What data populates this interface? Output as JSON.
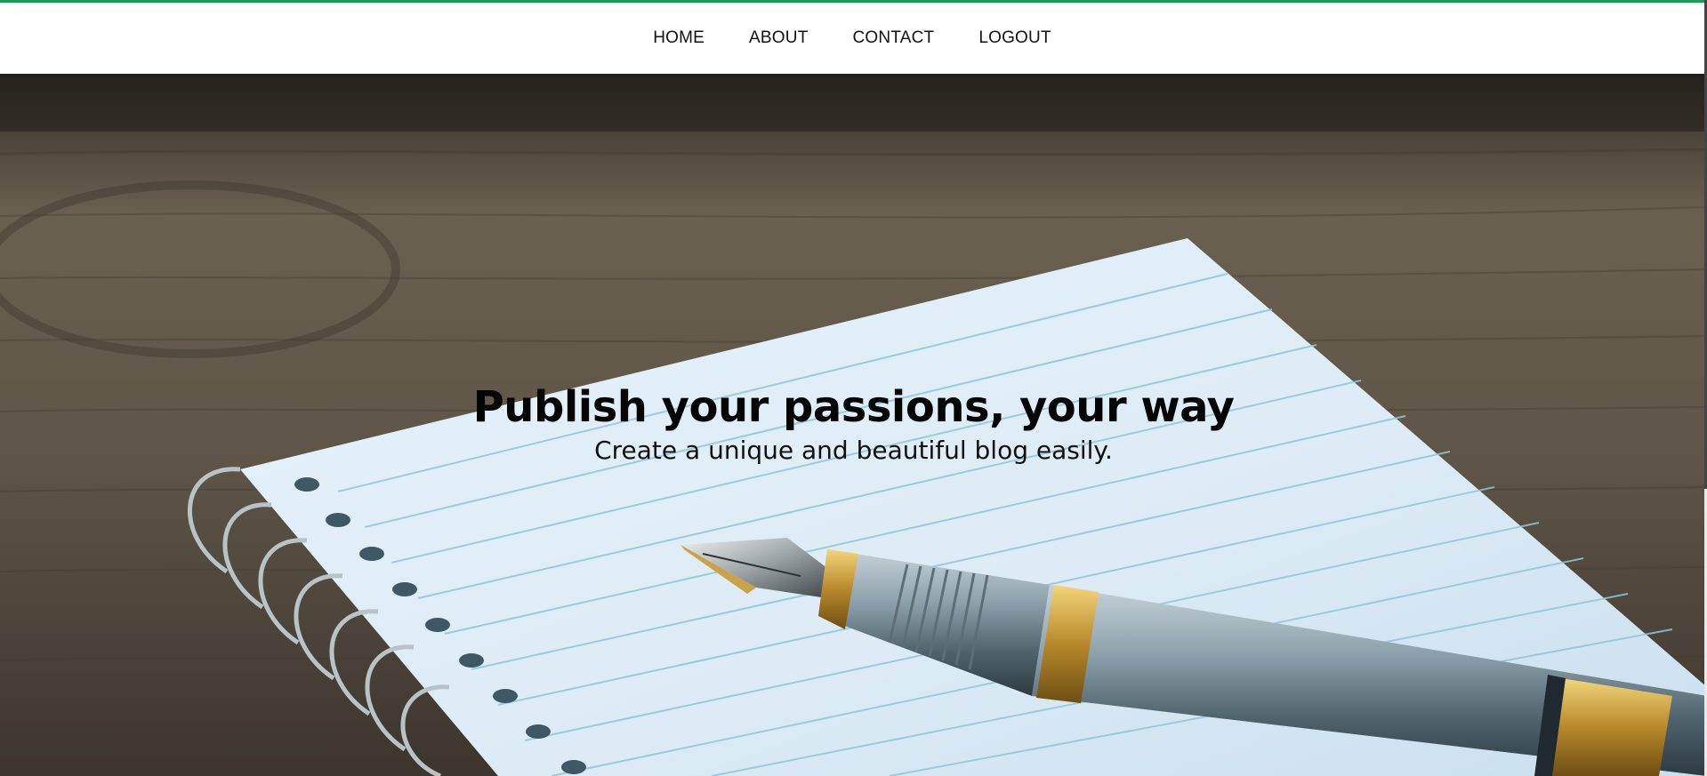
{
  "nav": {
    "items": [
      {
        "label": "HOME"
      },
      {
        "label": "ABOUT"
      },
      {
        "label": "CONTACT"
      },
      {
        "label": "LOGOUT"
      }
    ]
  },
  "hero": {
    "title": "Publish your passions, your way",
    "subtitle": "Create a unique and beautiful blog easily."
  },
  "colors": {
    "accent": "#1f9a5a",
    "nav_background": "#ffffff",
    "text": "#111111"
  }
}
